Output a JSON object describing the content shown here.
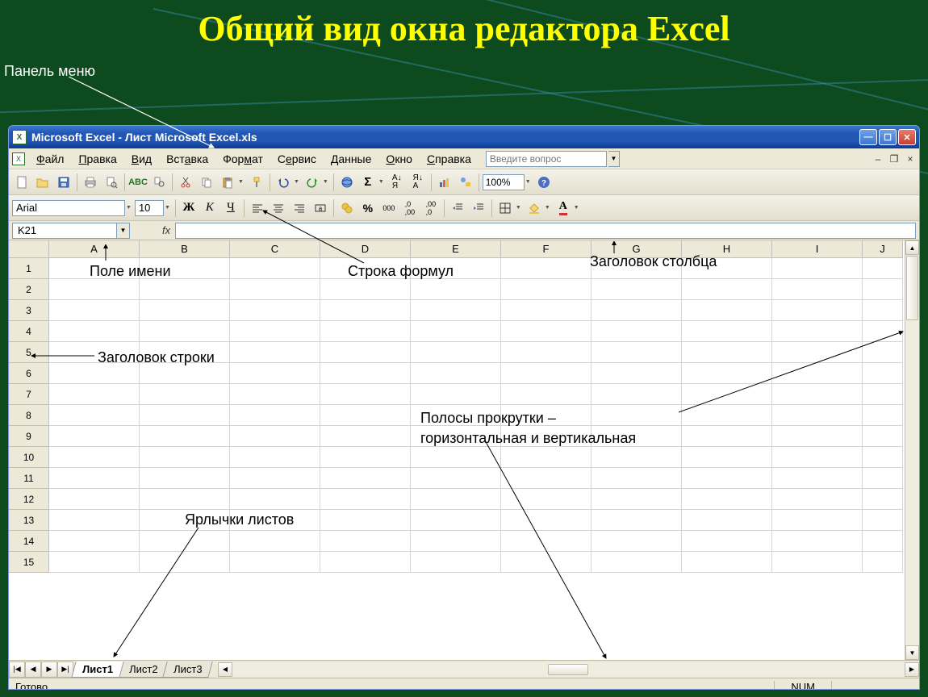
{
  "slide": {
    "title": "Общий вид окна редактора Excel",
    "label_panel_menu": "Панель меню"
  },
  "titlebar": {
    "text": "Microsoft Excel - Лист Microsoft Excel.xls"
  },
  "menubar": {
    "file": "Файл",
    "edit": "Правка",
    "view": "Вид",
    "insert": "Вставка",
    "format": "Формат",
    "tools": "Сервис",
    "data": "Данные",
    "window": "Окно",
    "help": "Справка",
    "help_placeholder": "Введите вопрос"
  },
  "namebox": {
    "cell_ref": "K21"
  },
  "format_toolbar": {
    "font_name": "Arial",
    "font_size": "10",
    "bold": "Ж",
    "italic": "К",
    "underline": "Ч",
    "currency_icon": "%",
    "thousands_icon": "000",
    "zoom": "100%"
  },
  "columns": [
    "A",
    "B",
    "C",
    "D",
    "E",
    "F",
    "G",
    "H",
    "I",
    "J"
  ],
  "rows": [
    "1",
    "2",
    "3",
    "4",
    "5",
    "6",
    "7",
    "8",
    "9",
    "10",
    "11",
    "12",
    "13",
    "14",
    "15"
  ],
  "sheet_tabs": {
    "tab1": "Лист1",
    "tab2": "Лист2",
    "tab3": "Лист3"
  },
  "statusbar": {
    "ready": "Готово",
    "num": "NUM"
  },
  "annotations": {
    "name_field": "Поле имени",
    "formula_bar": "Строка формул",
    "column_header": "Заголовок столбца",
    "row_header": "Заголовок строки",
    "scrollbars": "Полосы прокрутки –\nгоризонтальная и вертикальная",
    "sheet_tabs": "Ярлычки листов"
  }
}
